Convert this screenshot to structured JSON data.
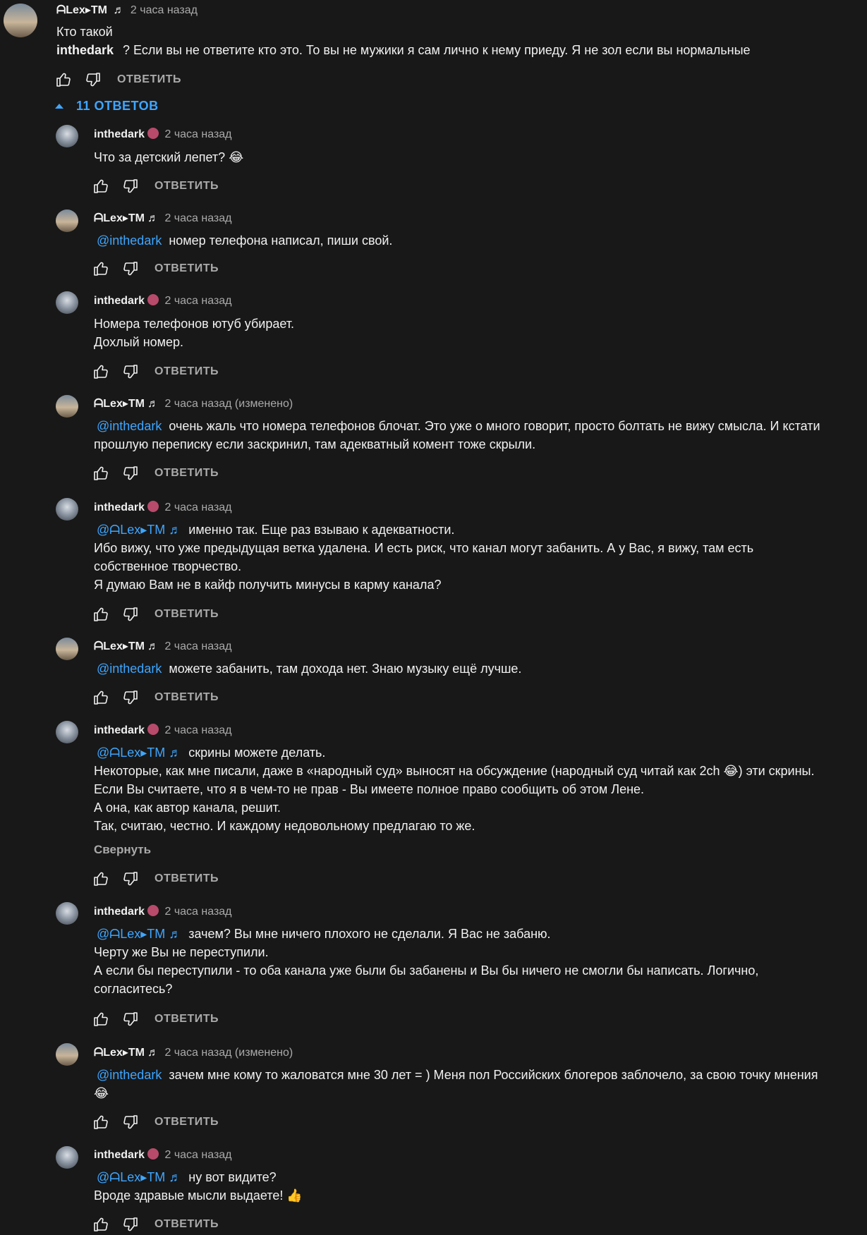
{
  "main_comment": {
    "author": "ᗩLex▸TM",
    "time": "2 часа назад",
    "lines": [
      "Кто такой"
    ],
    "mention": "inthedark",
    "text_after_mention": "? Если вы не ответите кто это. То вы не мужики я сам лично к нему приеду. Я не зол если вы нормальные"
  },
  "labels": {
    "reply": "ОТВЕТИТЬ",
    "replies_toggle": "11 ОТВЕТОВ",
    "collapse": "Свернуть",
    "edited": "(изменено)"
  },
  "replies": [
    {
      "author": "inthedark",
      "time": "2 часа назад",
      "lines": [
        "Что за детский лепет? 😂"
      ]
    },
    {
      "author": "ᗩLex▸TM",
      "time": "2 часа назад",
      "mention": "@inthedark",
      "lines": [
        "номер телефона написал, пиши свой."
      ]
    },
    {
      "author": "inthedark",
      "time": "2 часа назад",
      "lines": [
        "Номера телефонов ютуб убирает.",
        "Дохлый номер."
      ]
    },
    {
      "author": "ᗩLex▸TM",
      "time": "2 часа назад (изменено)",
      "mention": "@inthedark",
      "lines": [
        "очень жаль что номера телефонов блочат. Это уже о много говорит, просто болтать не вижу смысла. И кстати",
        "прошлую переписку если заскринил, там адекватный комент тоже скрыли."
      ]
    },
    {
      "author": "inthedark",
      "time": "2 часа назад",
      "mention": "@ᗩLex▸TM ♬",
      "lines": [
        "именно так. Еще раз взываю к адекватности.",
        "Ибо вижу, что уже предыдущая ветка удалена. И есть риск, что канал могут забанить. А у Вас, я вижу, там есть",
        "собственное творчество.",
        "Я думаю Вам не в кайф получить минусы в карму канала?"
      ]
    },
    {
      "author": "ᗩLex▸TM",
      "time": "2 часа назад",
      "mention": "@inthedark",
      "lines": [
        "можете забанить, там дохода нет. Знаю музыку ещё лучше."
      ]
    },
    {
      "author": "inthedark",
      "time": "2 часа назад",
      "mention": "@ᗩLex▸TM ♬",
      "lines": [
        "скрины можете делать.",
        "Некоторые, как мне писали, даже в «народный суд» выносят на обсуждение (народный суд читай как 2ch 😂) эти скрины.",
        "Если Вы считаете, что я в чем-то не прав - Вы имеете полное право сообщить об этом Лене.",
        "А она, как автор канала, решит.",
        "Так, считаю, честно. И каждому недовольному предлагаю то же."
      ]
    },
    {
      "author": "inthedark",
      "time": "2 часа назад",
      "mention": "@ᗩLex▸TM ♬",
      "lines": [
        "зачем? Вы мне ничего плохого не сделали. Я Вас не забаню.",
        "Черту же Вы не переступили.",
        "А если бы переступили - то оба канала уже были бы забанены и Вы бы ничего не смогли бы написать. Логично,",
        "согласитесь?"
      ]
    },
    {
      "author": "ᗩLex▸TM",
      "time": "2 часа назад (изменено)",
      "mention": "@inthedark",
      "lines": [
        "зачем мне кому то жаловатся мне 30 лет = ) Меня пол Российских блогеров заблочело, за свою точку мнения",
        "😂"
      ]
    },
    {
      "author": "inthedark",
      "time": "2 часа назад",
      "mention": "@ᗩLex▸TM ♬",
      "lines": [
        "ну вот видите?",
        "Вроде здравые мысли выдаете! 👍"
      ]
    }
  ],
  "icons": {
    "like": "thumbs-up-icon",
    "dislike": "thumbs-down-icon",
    "toggle": "chevron-up-icon",
    "note": "music-note-icon",
    "badge": "flower-badge-icon"
  },
  "colors": {
    "background": "#181818",
    "text": "#f1f1f1",
    "secondary": "#aaaaaa",
    "link": "#3ea6ff"
  }
}
